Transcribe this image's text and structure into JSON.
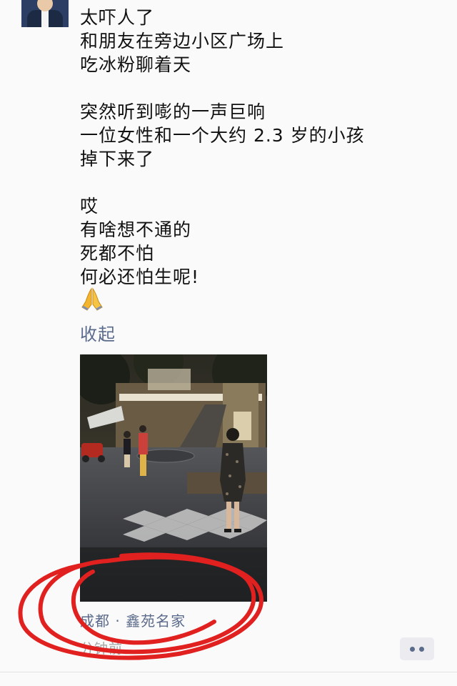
{
  "post": {
    "lines": [
      "太吓人了",
      "和朋友在旁边小区广场上",
      "吃冰粉聊着天",
      "",
      "突然听到嘭的一声巨响",
      "一位女性和一个大约 2.3 岁的小孩",
      "掉下来了",
      "",
      "哎",
      "有啥想不通的",
      "死都不怕",
      "何必还怕生呢!"
    ],
    "emoji": "praying-hands-emoji",
    "collapse_label": "收起",
    "location": "成都 · 鑫苑名家",
    "time": "分钟前"
  },
  "colors": {
    "link": "#5b6b8c",
    "annotation_red": "#e0211f"
  }
}
